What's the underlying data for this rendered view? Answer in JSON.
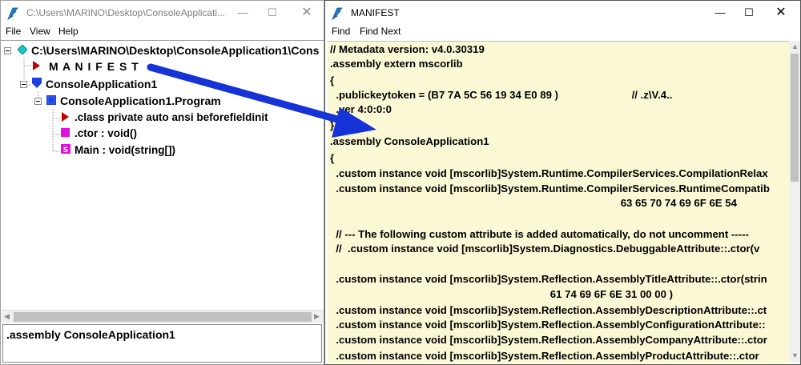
{
  "left_window": {
    "title": "C:\\Users\\MARINO\\Desktop\\ConsoleApplicati...",
    "menu": [
      "File",
      "View",
      "Help"
    ],
    "tree": {
      "root": "C:\\Users\\MARINO\\Desktop\\ConsoleApplication1\\Cons",
      "manifest": "M A N I F E S T",
      "namespace": "ConsoleApplication1",
      "class": "ConsoleApplication1.Program",
      "class_decl": ".class private auto ansi beforefieldinit",
      "ctor": ".ctor : void()",
      "main": "Main : void(string[])"
    },
    "status": ".assembly ConsoleApplication1"
  },
  "right_window": {
    "title": "MANIFEST",
    "menu": [
      "Find",
      "Find Next"
    ],
    "code_lines": [
      "// Metadata version: v4.0.30319",
      ".assembly extern mscorlib",
      "{",
      "  .publickeytoken = (B7 7A 5C 56 19 34 E0 89 )                         // .z\\V.4..",
      "  .ver 4:0:0:0",
      "}",
      ".assembly ConsoleApplication1",
      "{",
      "  .custom instance void [mscorlib]System.Runtime.CompilerServices.CompilationRelax",
      "  .custom instance void [mscorlib]System.Runtime.CompilerServices.RuntimeCompatib",
      "                                                                                                   63 65 70 74 69 6F 6E 54",
      "",
      "  // --- The following custom attribute is added automatically, do not uncomment -----",
      "  //  .custom instance void [mscorlib]System.Diagnostics.DebuggableAttribute::.ctor(v",
      "",
      "  .custom instance void [mscorlib]System.Reflection.AssemblyTitleAttribute::.ctor(strin",
      "                                                                           61 74 69 6F 6E 31 00 00 )",
      "  .custom instance void [mscorlib]System.Reflection.AssemblyDescriptionAttribute::.ct",
      "  .custom instance void [mscorlib]System.Reflection.AssemblyConfigurationAttribute::",
      "  .custom instance void [mscorlib]System.Reflection.AssemblyCompanyAttribute::.ctor",
      "  .custom instance void [mscorlib]System.Reflection.AssemblyProductAttribute::.ctor"
    ]
  },
  "colors": {
    "code_bg": "#fbf8d6",
    "arrow": "#1533d6",
    "manifest_icon": "#c00000",
    "class_icon": "#1f3fe0",
    "method_icon": "#e010e0",
    "root_icon": "#19c7c7"
  },
  "icons": {
    "app": "ildasm-quill-icon",
    "minimize": "minimize-icon",
    "maximize": "maximize-icon",
    "close": "close-icon"
  }
}
